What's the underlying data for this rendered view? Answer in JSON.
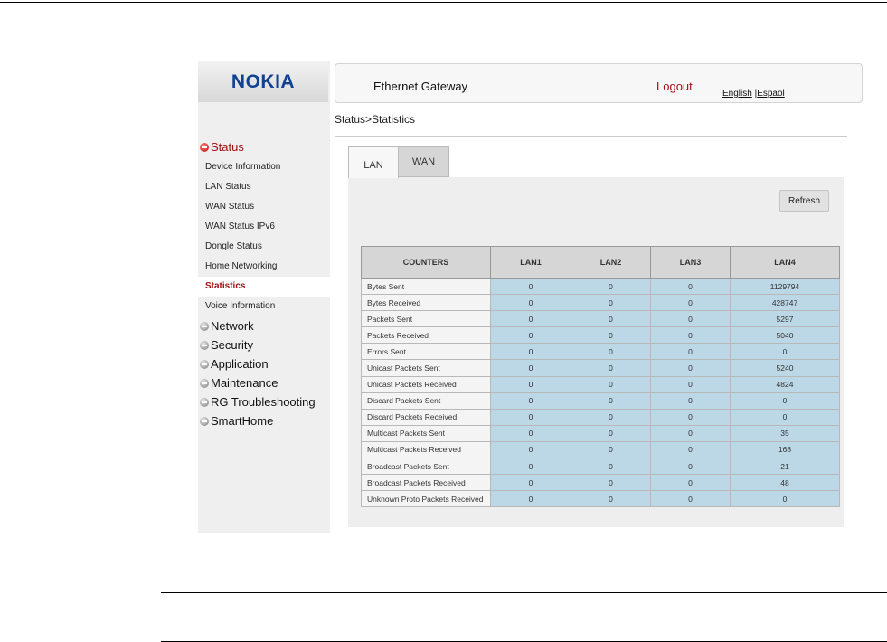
{
  "brand": "NOKIA",
  "header": {
    "title": "Ethernet Gateway",
    "logout": "Logout",
    "lang_english": "English",
    "lang_sep": " |",
    "lang_espanol": "Espaol"
  },
  "breadcrumb": "Status>Statistics",
  "tabs": [
    {
      "label": "LAN",
      "active": true
    },
    {
      "label": "WAN",
      "active": false
    }
  ],
  "refresh_label": "Refresh",
  "sidebar": {
    "status": "Status",
    "status_items": [
      "Device Information",
      "LAN Status",
      "WAN Status",
      "WAN Status IPv6",
      "Dongle Status",
      "Home Networking",
      "Statistics",
      "Voice Information"
    ],
    "sections": [
      "Network",
      "Security",
      "Application",
      "Maintenance",
      "RG Troubleshooting",
      "SmartHome"
    ]
  },
  "table": {
    "headers": [
      "COUNTERS",
      "LAN1",
      "LAN2",
      "LAN3",
      "LAN4"
    ],
    "rows": [
      [
        "Bytes Sent",
        "0",
        "0",
        "0",
        "1129794"
      ],
      [
        "Bytes Received",
        "0",
        "0",
        "0",
        "428747"
      ],
      [
        "Packets Sent",
        "0",
        "0",
        "0",
        "5297"
      ],
      [
        "Packets Received",
        "0",
        "0",
        "0",
        "5040"
      ],
      [
        "Errors Sent",
        "0",
        "0",
        "0",
        "0"
      ],
      [
        "Unicast Packets Sent",
        "0",
        "0",
        "0",
        "5240"
      ],
      [
        "Unicast Packets Received",
        "0",
        "0",
        "0",
        "4824"
      ],
      [
        "Discard Packets Sent",
        "0",
        "0",
        "0",
        "0"
      ],
      [
        "Discard Packets Received",
        "0",
        "0",
        "0",
        "0"
      ],
      [
        "Multicast Packets Sent",
        "0",
        "0",
        "0",
        "35"
      ],
      [
        "Multicast Packets Received",
        "0",
        "0",
        "0",
        "168"
      ],
      [
        "Broadcast Packets Sent",
        "0",
        "0",
        "0",
        "21"
      ],
      [
        "Broadcast Packets Received",
        "0",
        "0",
        "0",
        "48"
      ],
      [
        "Unknown Proto Packets Received",
        "0",
        "0",
        "0",
        "0"
      ]
    ]
  }
}
